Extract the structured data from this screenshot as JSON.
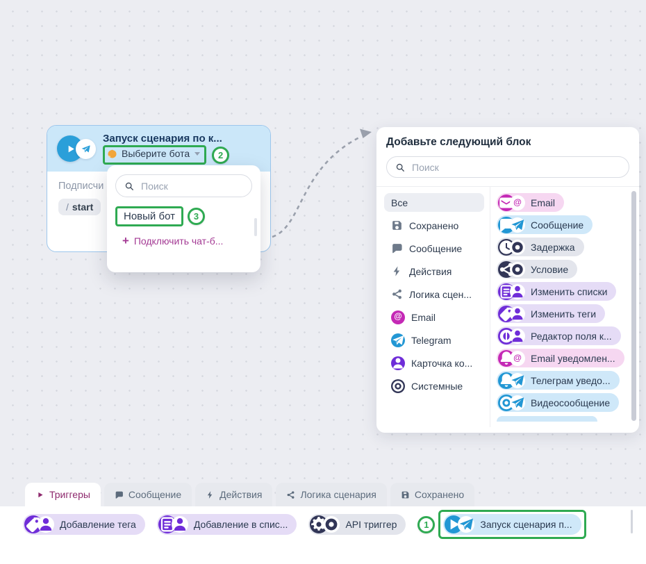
{
  "colors": {
    "green_highlight": "#2faa52",
    "magenta": "#c429b5",
    "blue": "#2297d4",
    "purple": "#6f2dd8",
    "navy": "#323657",
    "pink_chip_bg": "#f6d7f1",
    "blue_chip_bg": "#cfe8f9",
    "grey_chip_bg": "#e3e5ec",
    "purple_chip_bg": "#e5dcf6",
    "node_header_bg": "#cbe7f9",
    "active_tab_text": "#8e296d"
  },
  "badges": {
    "step1": "1",
    "step2": "2",
    "step3": "3"
  },
  "node": {
    "title": "Запуск сценария по к...",
    "bot_select_label": "Выберите бота",
    "body_text": "Подписчи",
    "command_prefix": "/",
    "command": "start"
  },
  "dropdown": {
    "search_placeholder": "Поиск",
    "item_label": "Новый бот",
    "plus": "+",
    "connect_link_label": "Подключить чат-б..."
  },
  "panel": {
    "title": "Добавьте следующий блок",
    "search_placeholder": "Поиск",
    "categories": [
      {
        "label": "Все",
        "icon": "",
        "style": "none",
        "selected": true
      },
      {
        "label": "Сохранено",
        "icon": "save-icon",
        "style": "plain"
      },
      {
        "label": "Сообщение",
        "icon": "chat-bubble-icon",
        "style": "plain"
      },
      {
        "label": "Действия",
        "icon": "lightning-icon",
        "style": "plain"
      },
      {
        "label": "Логика сцен...",
        "icon": "share-icon",
        "style": "plain"
      },
      {
        "label": "Email",
        "icon": "at-icon",
        "style": "magenta"
      },
      {
        "label": "Telegram",
        "icon": "telegram-icon",
        "style": "blue"
      },
      {
        "label": "Карточка ко...",
        "icon": "person-icon",
        "style": "purple"
      },
      {
        "label": "Системные",
        "icon": "target-icon",
        "style": "navy"
      }
    ],
    "blocks": [
      {
        "label": "Email",
        "color": "pink",
        "icon1": "envelope-icon",
        "icon2": "at-icon"
      },
      {
        "label": "Сообщение",
        "color": "blue",
        "icon1": "chat-bubble-icon",
        "icon2": "telegram-icon"
      },
      {
        "label": "Задержка",
        "color": "grey",
        "icon1": "clock-icon",
        "icon2": "ring-icon"
      },
      {
        "label": "Условие",
        "color": "grey",
        "icon1": "share-icon",
        "icon2": "ring-icon"
      },
      {
        "label": "Изменить списки",
        "color": "purple",
        "icon1": "list-icon",
        "icon2": "person-icon"
      },
      {
        "label": "Изменить теги",
        "color": "purple",
        "icon1": "tag-icon",
        "icon2": "person-icon"
      },
      {
        "label": "Редактор поля к...",
        "color": "purple",
        "icon1": "field-icon",
        "icon2": "person-icon"
      },
      {
        "label": "Email уведомлен...",
        "color": "pink",
        "icon1": "bell-icon",
        "icon2": "at-icon"
      },
      {
        "label": "Телеграм уведо...",
        "color": "blue",
        "icon1": "bell-icon",
        "icon2": "telegram-icon"
      },
      {
        "label": "Видеосообщение",
        "color": "blue",
        "icon1": "target-icon",
        "icon2": "telegram-icon"
      }
    ]
  },
  "tabs": [
    {
      "label": "Триггеры",
      "icon": "play-icon",
      "active": true
    },
    {
      "label": "Сообщение",
      "icon": "chat-bubble-icon"
    },
    {
      "label": "Действия",
      "icon": "lightning-icon"
    },
    {
      "label": "Логика сценария",
      "icon": "share-icon"
    },
    {
      "label": "Сохранено",
      "icon": "save-icon"
    }
  ],
  "tray": {
    "chips": [
      {
        "label": "Добавление тега",
        "color": "purple",
        "icon1": "tag-icon",
        "icon2": "person-icon"
      },
      {
        "label": "Добавление в спис...",
        "color": "purple",
        "icon1": "list-icon",
        "icon2": "person-icon"
      },
      {
        "label": "API триггер",
        "color": "grey",
        "icon1": "gear-icon",
        "icon2": "ring-icon"
      },
      {
        "label": "Запуск сценария п...",
        "color": "blue",
        "icon1": "play-icon",
        "icon2": "telegram-icon",
        "badge": "1",
        "highlighted": true
      }
    ]
  }
}
